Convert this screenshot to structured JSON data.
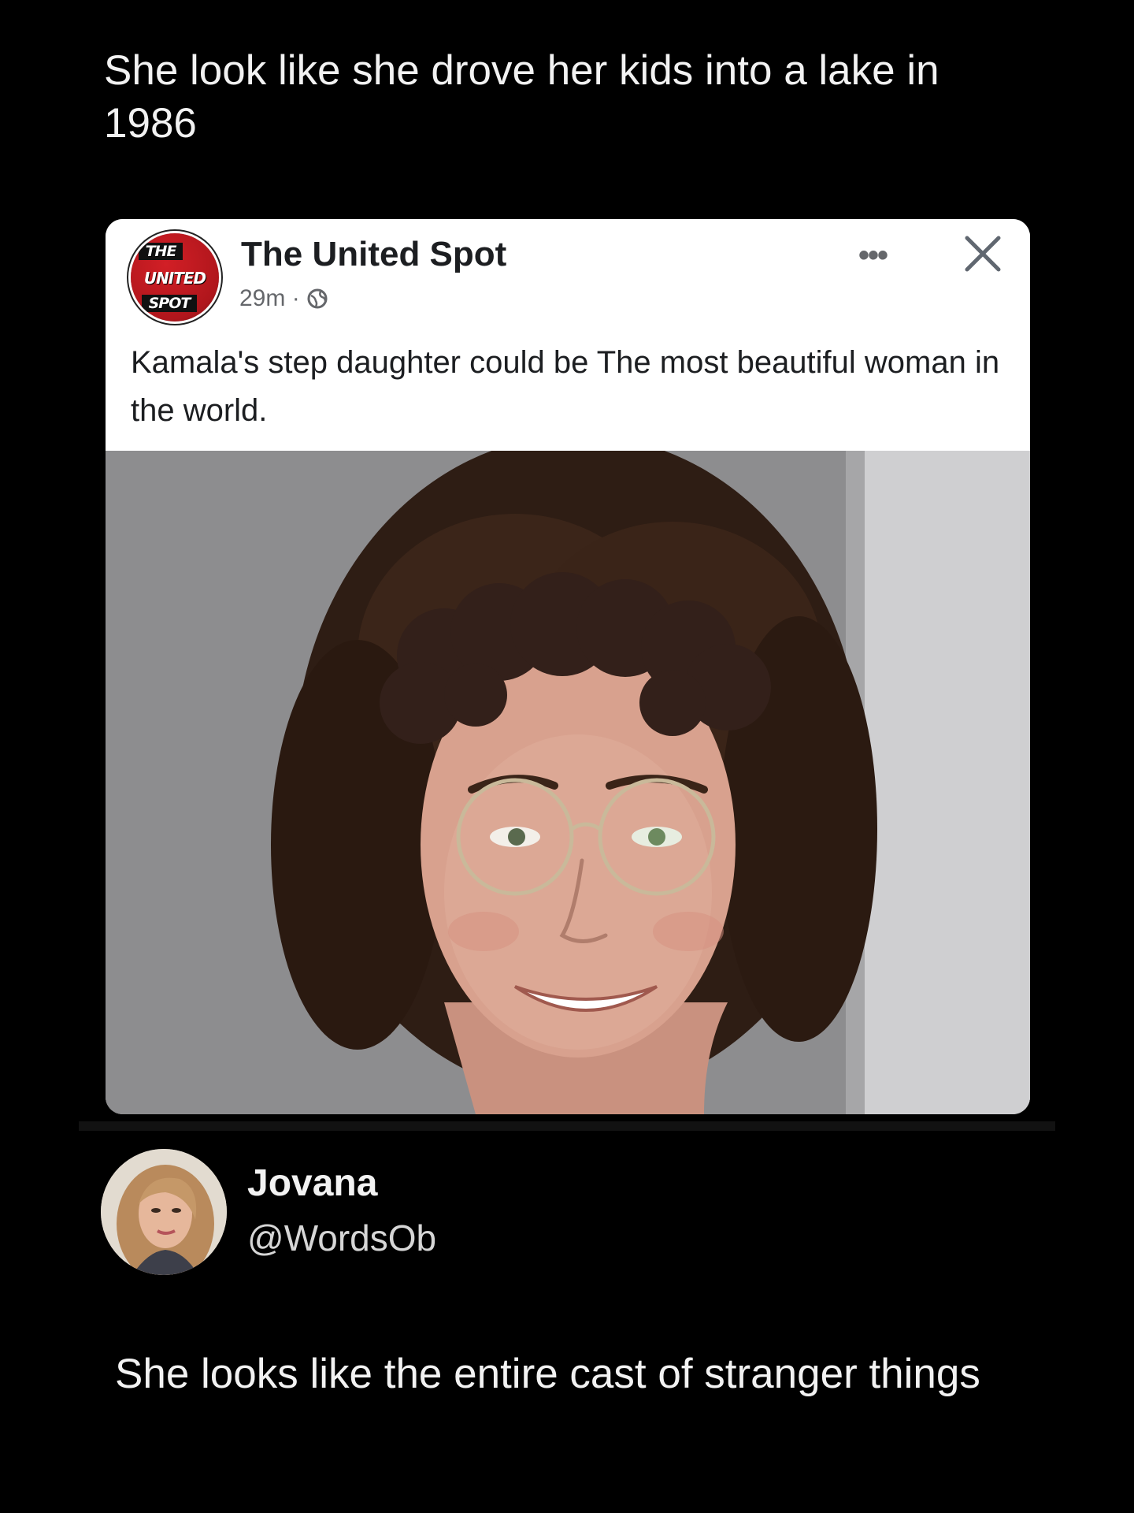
{
  "top_tweet": {
    "text": "She look like she drove her kids into a lake in 1986"
  },
  "quoted_post": {
    "logo": {
      "line1": "THE",
      "line2": "UNITED",
      "line3": "SPOT"
    },
    "page_name": "The United Spot",
    "timestamp": "29m ·",
    "more_label": "•••",
    "text": "Kamala's step daughter could be The most beautiful woman in the world.",
    "icons": [
      "globe-icon",
      "more-icon",
      "close-icon"
    ]
  },
  "reply": {
    "display_name": "Jovana",
    "handle": "@WordsOb",
    "text": "She looks like the entire cast of stranger things"
  },
  "colors": {
    "background": "#000000",
    "card_background": "#ffffff",
    "page_name_color": "#1c1e21",
    "meta_color": "#65676b",
    "logo_red": "#c41a20"
  }
}
